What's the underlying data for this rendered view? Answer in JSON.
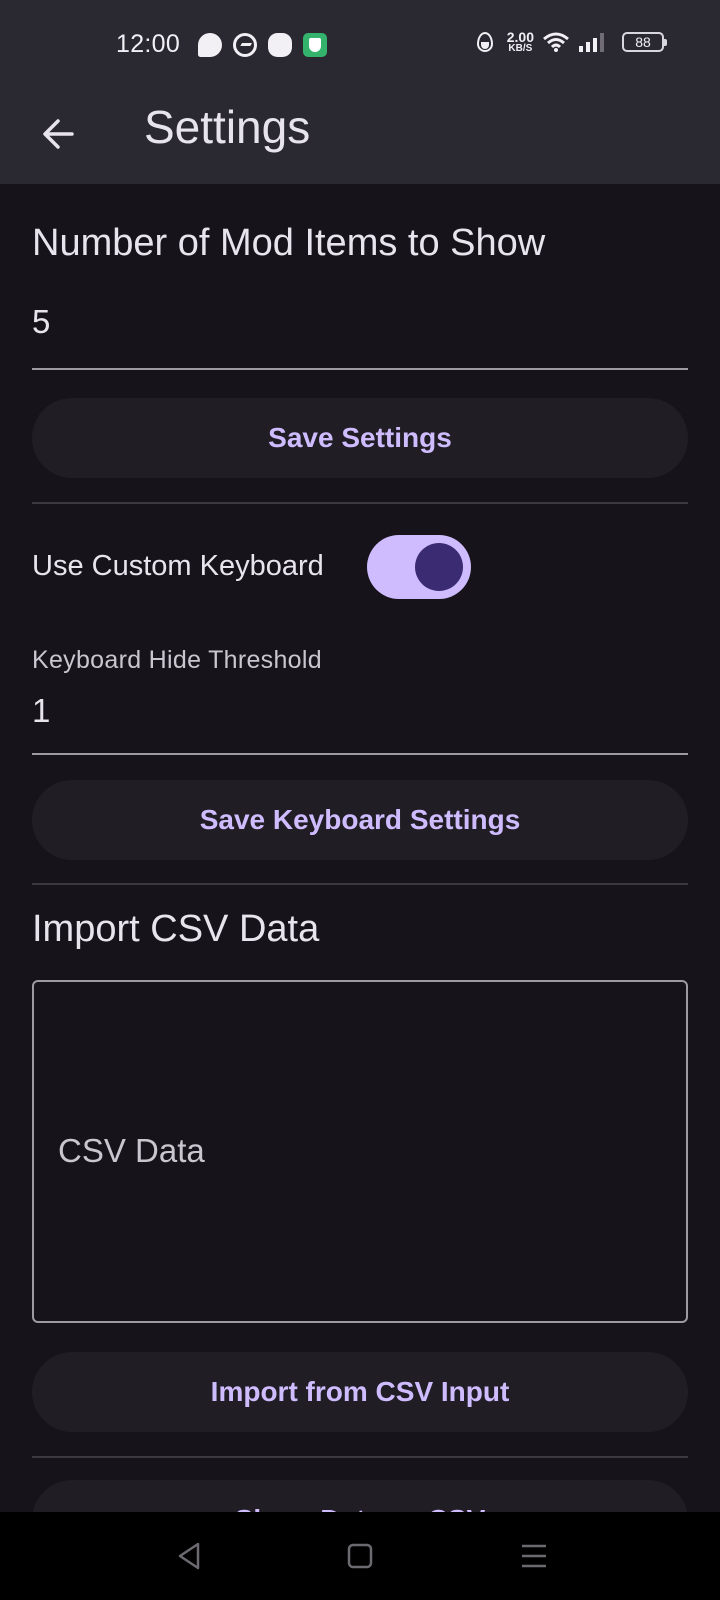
{
  "status_bar": {
    "time": "12:00",
    "network_speed_value": "2.00",
    "network_speed_unit": "KB/S",
    "battery": "88"
  },
  "app_bar": {
    "title": "Settings",
    "back_icon": "arrow-left-icon"
  },
  "mod_items": {
    "label": "Number of Mod Items to Show",
    "value": "5",
    "save_label": "Save Settings"
  },
  "keyboard": {
    "toggle_label": "Use Custom Keyboard",
    "toggle_on": true,
    "threshold_label": "Keyboard Hide Threshold",
    "threshold_value": "1",
    "save_label": "Save Keyboard Settings"
  },
  "csv": {
    "heading": "Import CSV Data",
    "placeholder": "CSV Data",
    "import_label": "Import from CSV Input",
    "share_label": "Share Data as CSV"
  },
  "colors": {
    "accent": "#cfbcff",
    "background": "#16141a",
    "app_bar": "#2a2831"
  }
}
